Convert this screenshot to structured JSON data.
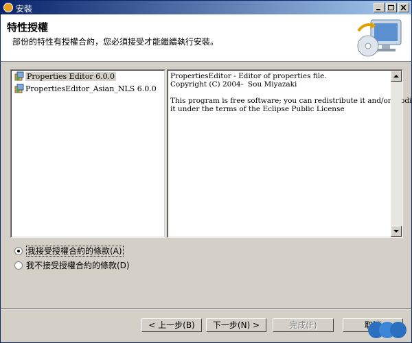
{
  "window": {
    "title": "安裝"
  },
  "header": {
    "title": "特性授權",
    "description": "部份的特性有授權合約，您必須接受才能繼續執行安裝。"
  },
  "features": [
    {
      "label": "Properties Editor 6.0.0",
      "selected": true
    },
    {
      "label": "PropertiesEditor_Asian_NLS 6.0.0",
      "selected": false
    }
  ],
  "license": {
    "text": "PropertiesEditor - Editor of properties file.\nCopyright (C) 2004-  Sou Miyazaki\n\nThis program is free software; you can redistribute it and/or modify\nit under the terms of the Eclipse Public License"
  },
  "options": [
    {
      "label": "我接受授權合約的條款(A)",
      "checked": true
    },
    {
      "label": "我不接受授權合約的條款(D)",
      "checked": false
    }
  ],
  "buttons": {
    "back": "< 上一步(B)",
    "next": "下一步(N) >",
    "finish": "完成(F)",
    "cancel": "取消"
  },
  "icons": {
    "app": "app-icon",
    "install_banner": "monitor-cd-icon",
    "feature": "plugin-icon"
  }
}
